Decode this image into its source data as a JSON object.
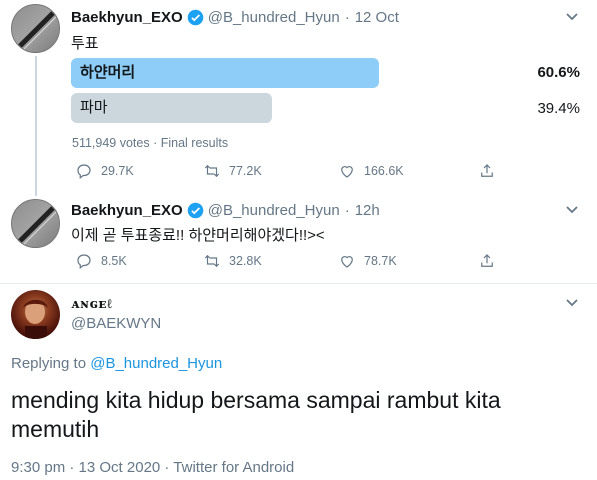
{
  "tweet1": {
    "name": "Baekhyun_EXO",
    "handle": "@B_hundred_Hyun",
    "time": "12 Oct",
    "text": "투표",
    "poll": {
      "options": [
        {
          "label": "하얀머리",
          "percent": "60.6%",
          "fraction": 0.606,
          "winner": true
        },
        {
          "label": "파마",
          "percent": "39.4%",
          "fraction": 0.394,
          "winner": false
        }
      ],
      "meta": "511,949 votes · Final results"
    },
    "actions": {
      "reply": "29.7K",
      "retweet": "77.2K",
      "like": "166.6K"
    }
  },
  "tweet2": {
    "name": "Baekhyun_EXO",
    "handle": "@B_hundred_Hyun",
    "time": "12h",
    "text": "이제 곧 투표종료!! 하얀머리해야겠다!!><",
    "actions": {
      "reply": "8.5K",
      "retweet": "32.8K",
      "like": "78.7K"
    }
  },
  "reply": {
    "name": "ᴀɴɢᴇℓ",
    "handle": "@BAEKWYN",
    "replying_prefix": "Replying to",
    "replying_handle": "@B_hundred_Hyun",
    "text": "mending kita hidup bersama sampai rambut kita memutih",
    "footer": "9:30 pm · 13 Oct 2020 · Twitter for Android"
  },
  "colors": {
    "accent": "#1b95e0",
    "poll_win": "#8ecdf8",
    "poll_lose": "#ccd6dd",
    "muted": "#657786"
  }
}
